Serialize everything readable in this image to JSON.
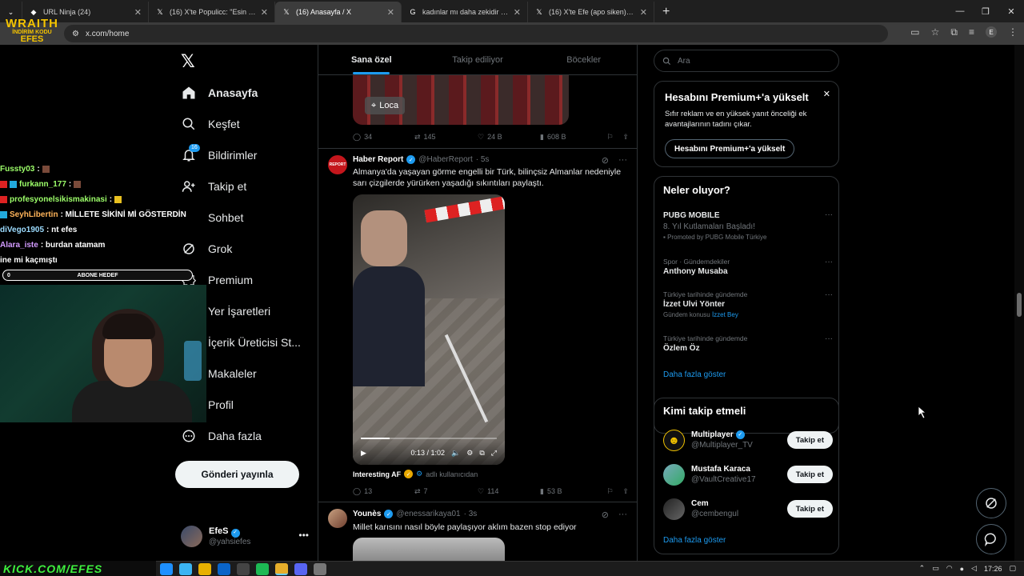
{
  "browser": {
    "tabs": [
      {
        "title": "URL Ninja (24)",
        "active": false
      },
      {
        "title": "(16) X'te Populicc: \"Esin Çepni'n",
        "active": false
      },
      {
        "title": "(16) Anasayfa / X",
        "active": true
      },
      {
        "title": "kadınlar mı daha zekidir erkekle",
        "active": false
      },
      {
        "title": "(16) X'te Efe (apo siken) 🇹🇷: \"Biz",
        "active": false
      }
    ],
    "url": "x.com/home"
  },
  "overlay": {
    "logo_big": "WRAITH",
    "logo_small": "İNDİRİM KODU",
    "logo_code": "EFES",
    "chat": [
      {
        "user": "Fussty03",
        "text": "",
        "color": "#9dff6a"
      },
      {
        "user": "furkann_177",
        "text": "",
        "color": "#9dff6a"
      },
      {
        "user": "profesyonelsikismakinasi",
        "text": "",
        "color": "#9dff6a"
      },
      {
        "user": "SeyhLibertin",
        "text": ": MİLLETE SİKİNİ Mİ GÖSTERDİN",
        "color": "#ffb45a"
      },
      {
        "user": "diVego1905",
        "text": ": nt efes",
        "color": "#9ddcff"
      },
      {
        "user": "Alara_iste",
        "text": ": burdan atamam",
        "color": "#d39bff"
      },
      {
        "user": "",
        "text": "ine mi kaçmıştı",
        "color": "#fff"
      }
    ],
    "goal_left": "0",
    "goal_label": "ABONE HEDEF",
    "url_banner": "KICK.COM/EFES"
  },
  "nav": {
    "items": [
      {
        "label": "Anasayfa",
        "icon": "home-icon"
      },
      {
        "label": "Keşfet",
        "icon": "search-icon"
      },
      {
        "label": "Bildirimler",
        "icon": "bell-icon",
        "badge": "16"
      },
      {
        "label": "Takip et",
        "icon": "person-add-icon"
      },
      {
        "label": "Sohbet",
        "icon": "chat-icon"
      },
      {
        "label": "Grok",
        "icon": "grok-icon"
      },
      {
        "label": "Premium",
        "icon": "x-premium-icon"
      },
      {
        "label": "Yer İşaretleri",
        "icon": "bookmark-icon"
      },
      {
        "label": "İçerik Üreticisi St...",
        "icon": "creator-studio-icon"
      },
      {
        "label": "Makaleler",
        "icon": "articles-icon"
      },
      {
        "label": "Profil",
        "icon": "profile-icon"
      },
      {
        "label": "Daha fazla",
        "icon": "more-circle-icon"
      }
    ],
    "post_button": "Gönderi yayınla",
    "me": {
      "name": "EfeS",
      "handle": "@yahsiefes"
    }
  },
  "timeline": {
    "tabs": [
      "Sana özel",
      "Takip ediliyor",
      "Böcekler"
    ],
    "post0": {
      "location": "Loca",
      "replies": "34",
      "reposts": "145",
      "likes": "24 B",
      "views": "608 B"
    },
    "post1": {
      "name": "Haber Report",
      "handle": "@HaberReport",
      "time": "· 5s",
      "avatar_text": "REPORT",
      "text": "Almanya'da yaşayan görme engelli bir Türk, bilinçsiz Almanlar nedeniyle sarı çizgilerde yürürken yaşadığı sıkıntıları paylaştı.",
      "video_time": "0:13 / 1:02",
      "video_progress": 0.21,
      "sub_name": "Interesting AF",
      "sub_user": "adlı kullanıcıdan",
      "replies": "13",
      "reposts": "7",
      "likes": "114",
      "views": "53 B"
    },
    "post2": {
      "name": "Younès",
      "handle": "@enessarikaya01",
      "time": "· 3s",
      "text": "Millet karısını nasıl böyle paylaşıyor aklım bazen stop ediyor"
    }
  },
  "right": {
    "search_placeholder": "Ara",
    "premium": {
      "title": "Hesabını Premium+'a yükselt",
      "text": "Sıfır reklam ve en yüksek yanıt önceliği ek avantajlarının tadını çıkar.",
      "button": "Hesabını Premium+'a yükselt"
    },
    "trends": {
      "title": "Neler oluyor?",
      "items": [
        {
          "cat": "",
          "title": "PUBG MOBILE",
          "sub": "8. Yıl Kutlamaları Başladı!",
          "meta": "Promoted by PUBG Mobile Türkiye"
        },
        {
          "cat": "Spor · Gündemdekiler",
          "title": "Anthony Musaba",
          "sub": "",
          "meta": ""
        },
        {
          "cat": "Türkiye tarihinde gündemde",
          "title": "İzzet Ulvi Yönter",
          "sub": "",
          "meta": "Gündem konusu",
          "meta_link": "İzzet Bey"
        },
        {
          "cat": "Türkiye tarihinde gündemde",
          "title": "Özlem Öz",
          "sub": "",
          "meta": ""
        }
      ],
      "show_more": "Daha fazla göster"
    },
    "who": {
      "title": "Kimi takip etmeli",
      "items": [
        {
          "name": "Multiplayer",
          "handle": "@Multiplayer_TV",
          "button": "Takip et"
        },
        {
          "name": "Mustafa Karaca",
          "handle": "@VaultCreative17",
          "button": "Takip et"
        },
        {
          "name": "Cem",
          "handle": "@cembengul",
          "button": "Takip et"
        }
      ],
      "show_more": "Daha fazla göster"
    }
  },
  "taskbar": {
    "time": "17:26"
  }
}
